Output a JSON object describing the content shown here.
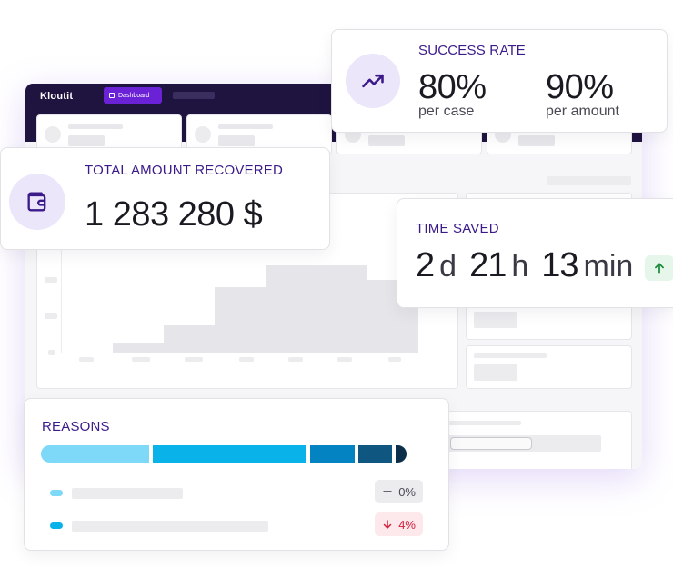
{
  "dashboard": {
    "logo": "Kloutit",
    "nav_active": "Dashboard"
  },
  "success_rate": {
    "title": "SUCCESS RATE",
    "icon": "trending-up-icon",
    "case_value": "80%",
    "case_label": "per case",
    "amount_value": "90%",
    "amount_label": "per amount"
  },
  "total_recovered": {
    "title": "TOTAL AMOUNT RECOVERED",
    "icon": "wallet-icon",
    "value": "1 283 280 $"
  },
  "time_saved": {
    "title": "TIME SAVED",
    "days": "2",
    "days_unit": "d",
    "hours": "21",
    "hours_unit": "h",
    "minutes": "13",
    "minutes_unit": "min",
    "trend_icon": "arrow-up-icon"
  },
  "reasons": {
    "title": "REASONS",
    "segments": [
      {
        "share": 0.29,
        "color": "#7dd9f7"
      },
      {
        "share": 0.41,
        "color": "#0ab2ea"
      },
      {
        "share": 0.12,
        "color": "#0383c2"
      },
      {
        "share": 0.09,
        "color": "#0f5780"
      },
      {
        "share": 0.03,
        "color": "#0b2f4a"
      }
    ],
    "rows": [
      {
        "color": "#7dd9f7",
        "change": "0%",
        "icon": "minus-icon",
        "bg": "#ececef",
        "fg": "#4a4a55"
      },
      {
        "color": "#0ab2ea",
        "change": "4%",
        "icon": "arrow-down-icon",
        "bg": "#fde9ec",
        "fg": "#d21f3c"
      }
    ]
  }
}
